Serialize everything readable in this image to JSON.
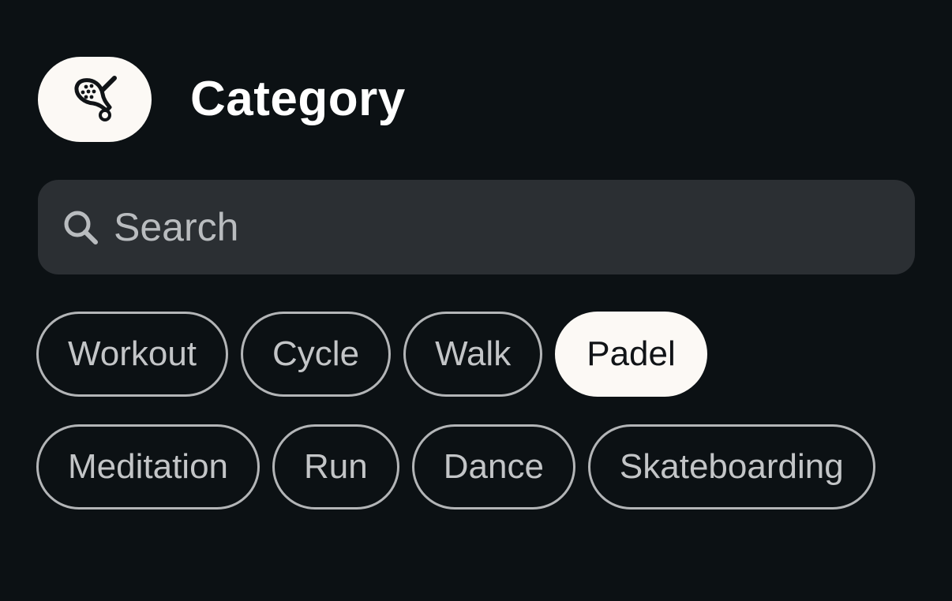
{
  "header": {
    "icon": "padel-racket-icon",
    "title": "Category"
  },
  "search": {
    "placeholder": "Search",
    "value": "",
    "icon": "search-icon"
  },
  "chips": {
    "row1": [
      {
        "label": "Workout",
        "selected": false
      },
      {
        "label": "Cycle",
        "selected": false
      },
      {
        "label": "Walk",
        "selected": false
      },
      {
        "label": "Padel",
        "selected": true
      }
    ],
    "row2": [
      {
        "label": "Meditation",
        "selected": false
      },
      {
        "label": "Run",
        "selected": false
      },
      {
        "label": "Dance",
        "selected": false
      },
      {
        "label": "Skateboarding",
        "selected": false
      }
    ]
  },
  "colors": {
    "background": "#0c1114",
    "search_bg": "#2b2f33",
    "chip_border": "#b3b5b7",
    "selected_bg": "#fcf9f5",
    "selected_text": "#111417"
  }
}
